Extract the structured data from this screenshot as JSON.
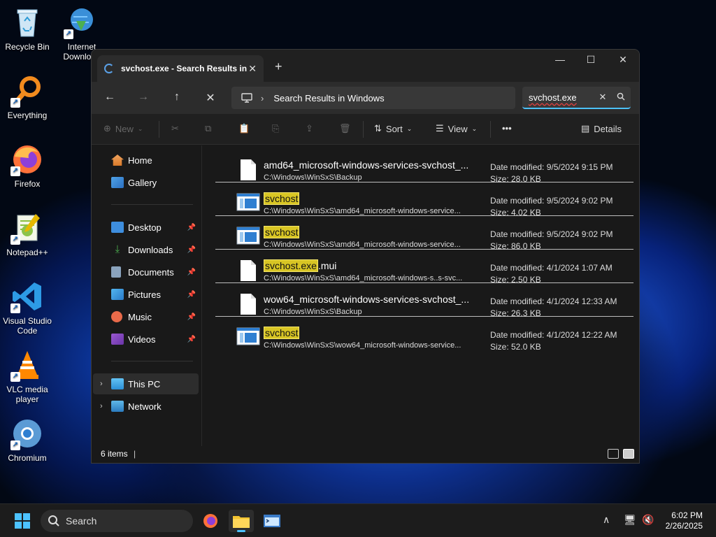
{
  "desktop": {
    "icons": [
      {
        "label": "Recycle Bin",
        "icon": "recycle-bin-icon"
      },
      {
        "label": "Internet Download",
        "icon": "internet-download-manager-icon"
      },
      {
        "label": "Everything",
        "icon": "everything-search-icon"
      },
      {
        "label": "Firefox",
        "icon": "firefox-icon"
      },
      {
        "label": "Notepad++",
        "icon": "notepad-plus-plus-icon"
      },
      {
        "label": "Visual Studio Code",
        "icon": "vscode-icon"
      },
      {
        "label": "VLC media player",
        "icon": "vlc-icon"
      },
      {
        "label": "Chromium",
        "icon": "chromium-icon"
      }
    ]
  },
  "window": {
    "tab_title": "svchost.exe - Search Results in",
    "address": "Search Results in Windows",
    "search_value": "svchost.exe",
    "commands": {
      "new": "New",
      "sort": "Sort",
      "view": "View",
      "more": "•••",
      "details": "Details"
    },
    "sidebar": {
      "home": "Home",
      "gallery": "Gallery",
      "desktop": "Desktop",
      "downloads": "Downloads",
      "documents": "Documents",
      "pictures": "Pictures",
      "music": "Music",
      "videos": "Videos",
      "this_pc": "This PC",
      "network": "Network"
    },
    "results": [
      {
        "name": "amd64_microsoft-windows-services-svchost_...",
        "name_hl": "",
        "name_rest": "",
        "path": "C:\\Windows\\WinSxS\\Backup",
        "date": "Date modified: 9/5/2024 9:15 PM",
        "size": "Size: 28.0 KB",
        "type": "file"
      },
      {
        "name": "",
        "name_hl": "svchost",
        "name_rest": "",
        "path": "C:\\Windows\\WinSxS\\amd64_microsoft-windows-service...",
        "date": "Date modified: 9/5/2024 9:02 PM",
        "size": "Size: 4.02 KB",
        "type": "exe"
      },
      {
        "name": "",
        "name_hl": "svchost",
        "name_rest": "",
        "path": "C:\\Windows\\WinSxS\\amd64_microsoft-windows-service...",
        "date": "Date modified: 9/5/2024 9:02 PM",
        "size": "Size: 86.0 KB",
        "type": "exe"
      },
      {
        "name": "",
        "name_hl": "svchost.exe",
        "name_rest": ".mui",
        "path": "C:\\Windows\\WinSxS\\amd64_microsoft-windows-s..s-svc...",
        "date": "Date modified: 4/1/2024 1:07 AM",
        "size": "Size: 2.50 KB",
        "type": "file"
      },
      {
        "name": "wow64_microsoft-windows-services-svchost_...",
        "name_hl": "",
        "name_rest": "",
        "path": "C:\\Windows\\WinSxS\\Backup",
        "date": "Date modified: 4/1/2024 12:33 AM",
        "size": "Size: 26.3 KB",
        "type": "file"
      },
      {
        "name": "",
        "name_hl": "svchost",
        "name_rest": "",
        "path": "C:\\Windows\\WinSxS\\wow64_microsoft-windows-service...",
        "date": "Date modified: 4/1/2024 12:22 AM",
        "size": "Size: 52.0 KB",
        "type": "exe"
      }
    ],
    "status_count": "6 items",
    "status_sep": "|"
  },
  "taskbar": {
    "search_label": "Search",
    "time": "6:02 PM",
    "date": "2/26/2025"
  }
}
